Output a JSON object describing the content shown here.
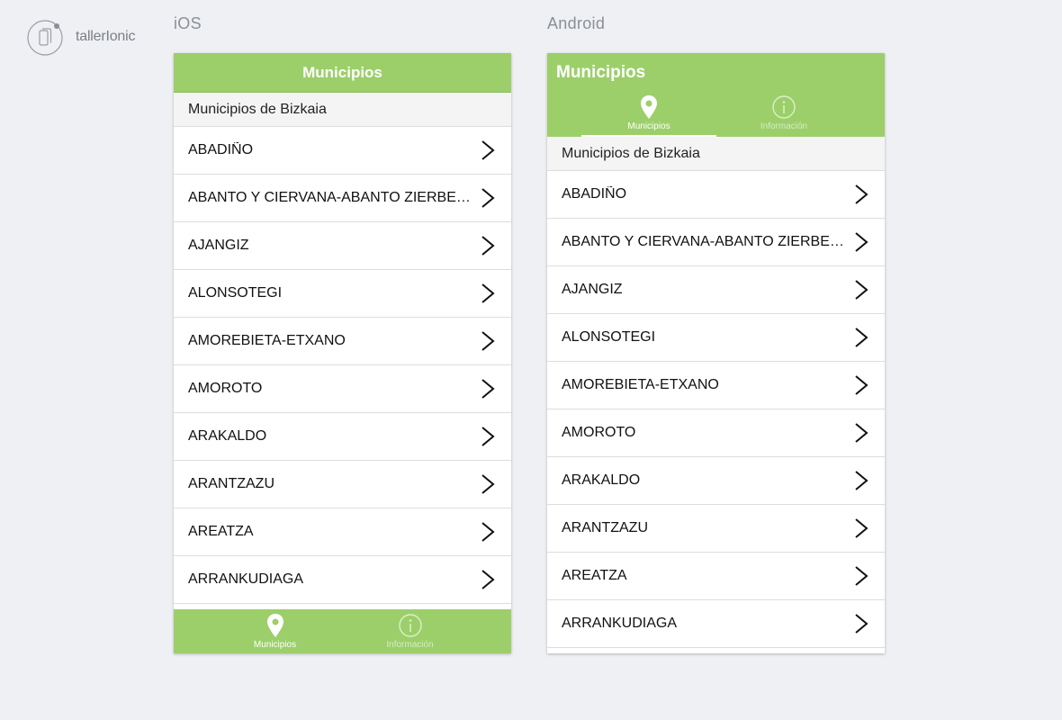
{
  "brand": {
    "name": "tallerIonic"
  },
  "ios": {
    "platform_label": "iOS",
    "header_title": "Municipios",
    "section_title": "Municipios de Bizkaia",
    "items": [
      "ABADIÑO",
      "ABANTO Y CIERVANA-ABANTO ZIERBENA",
      "AJANGIZ",
      "ALONSOTEGI",
      "AMOREBIETA-ETXANO",
      "AMOROTO",
      "ARAKALDO",
      "ARANTZAZU",
      "AREATZA",
      "ARRANKUDIAGA"
    ],
    "tabs": [
      {
        "label": "Municipios",
        "icon": "location-pin-icon",
        "active": true
      },
      {
        "label": "Información",
        "icon": "info-icon",
        "active": false
      }
    ]
  },
  "android": {
    "platform_label": "Android",
    "header_title": "Municipios",
    "section_title": "Municipios de Bizkaia",
    "items": [
      "ABADIÑO",
      "ABANTO Y CIERVANA-ABANTO ZIERBENA",
      "AJANGIZ",
      "ALONSOTEGI",
      "AMOREBIETA-ETXANO",
      "AMOROTO",
      "ARAKALDO",
      "ARANTZAZU",
      "AREATZA",
      "ARRANKUDIAGA"
    ],
    "tabs": [
      {
        "label": "Municipios",
        "icon": "location-pin-icon",
        "active": true
      },
      {
        "label": "Información",
        "icon": "info-icon",
        "active": false
      }
    ]
  },
  "colors": {
    "accent": "#9ccf6a",
    "background": "#eff0f4"
  }
}
